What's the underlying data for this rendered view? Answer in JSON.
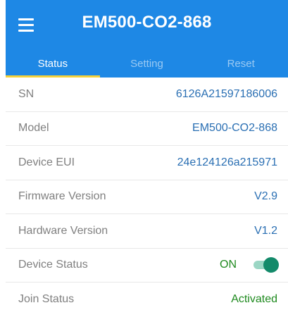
{
  "app": {
    "title": "EM500-CO2-868",
    "menu_icon": "hamburger-menu-icon"
  },
  "tabs": [
    {
      "label": "Status",
      "active": true
    },
    {
      "label": "Setting",
      "active": false
    },
    {
      "label": "Reset",
      "active": false
    }
  ],
  "colors": {
    "appbar": "#1e88e5",
    "tab_indicator": "#f5d13a",
    "value_blue": "#2a6fb3",
    "value_green": "#1f8a1f",
    "toggle_on": "#138a6a"
  },
  "status": {
    "sn": {
      "label": "SN",
      "value": "6126A21597186006"
    },
    "model": {
      "label": "Model",
      "value": "EM500-CO2-868"
    },
    "device_eui": {
      "label": "Device EUI",
      "value": "24e124126a215971"
    },
    "firmware": {
      "label": "Firmware Version",
      "value": "V2.9"
    },
    "hardware": {
      "label": "Hardware Version",
      "value": "V1.2"
    },
    "device_status": {
      "label": "Device Status",
      "value": "ON",
      "toggle_on": true
    },
    "join_status": {
      "label": "Join Status",
      "value": "Activated"
    }
  }
}
